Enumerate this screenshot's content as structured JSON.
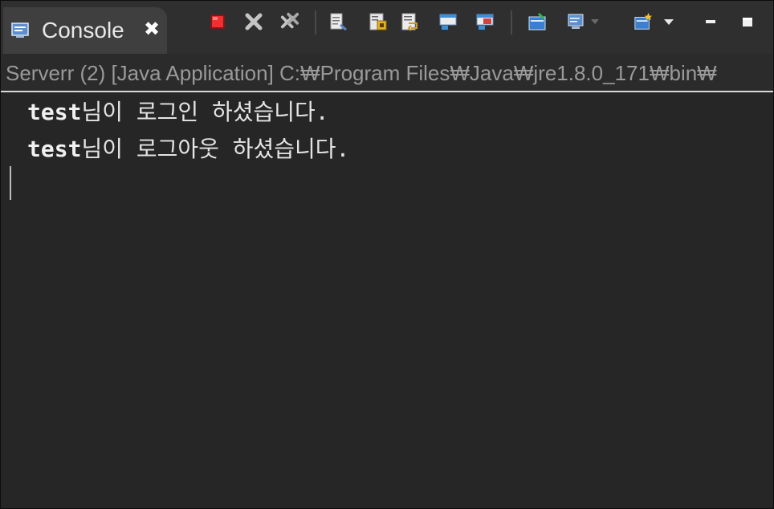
{
  "tab": {
    "title": "Console",
    "close_glyph": "✖"
  },
  "toolbar": {
    "icons": [
      "terminate-icon",
      "remove-launch-icon",
      "remove-all-terminated-icon",
      "clear-console-icon",
      "scroll-lock-icon",
      "word-wrap-icon",
      "show-on-stdout-icon",
      "show-on-stderr-icon",
      "pin-console-icon",
      "display-console-icon",
      "open-console-icon",
      "minimize-icon",
      "maximize-icon"
    ],
    "colors": {
      "terminate": "#e02020",
      "remove": "#b8b8b8",
      "stdout": "#3a8fd6",
      "stderr": "#d84040"
    }
  },
  "description": "Serverr (2) [Java Application] C:₩Program Files₩Java₩jre1.8.0_171₩bin₩",
  "output": {
    "lines": [
      {
        "user": "test",
        "message": "님이 로그인 하셨습니다."
      },
      {
        "user": "test",
        "message": "님이 로그아웃 하셨습니다."
      }
    ]
  }
}
